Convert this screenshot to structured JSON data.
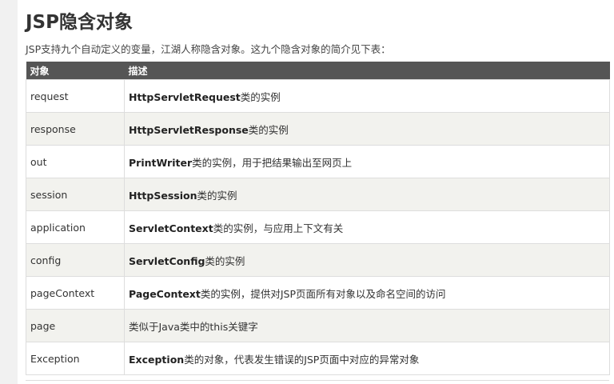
{
  "page": {
    "title": "JSP隐含对象",
    "intro": "JSP支持九个自动定义的变量，江湖人称隐含对象。这九个隐含对象的简介见下表："
  },
  "table": {
    "headers": [
      "对象",
      "描述"
    ],
    "rows": [
      {
        "object": "request",
        "cls": "HttpServletRequest",
        "desc": "类的实例"
      },
      {
        "object": "response",
        "cls": "HttpServletResponse",
        "desc": "类的实例"
      },
      {
        "object": "out",
        "cls": "PrintWriter",
        "desc": "类的实例，用于把结果输出至网页上"
      },
      {
        "object": "session",
        "cls": "HttpSession",
        "desc": "类的实例"
      },
      {
        "object": "application",
        "cls": "ServletContext",
        "desc": "类的实例，与应用上下文有关"
      },
      {
        "object": "config",
        "cls": "ServletConfig",
        "desc": "类的实例"
      },
      {
        "object": "pageContext",
        "cls": "PageContext",
        "desc": "类的实例，提供对JSP页面所有对象以及命名空间的访问"
      },
      {
        "object": "page",
        "cls": "",
        "desc": "类似于Java类中的this关键字"
      },
      {
        "object": "Exception",
        "cls": "Exception",
        "desc": "类的对象，代表发生错误的JSP页面中对应的异常对象"
      }
    ]
  }
}
